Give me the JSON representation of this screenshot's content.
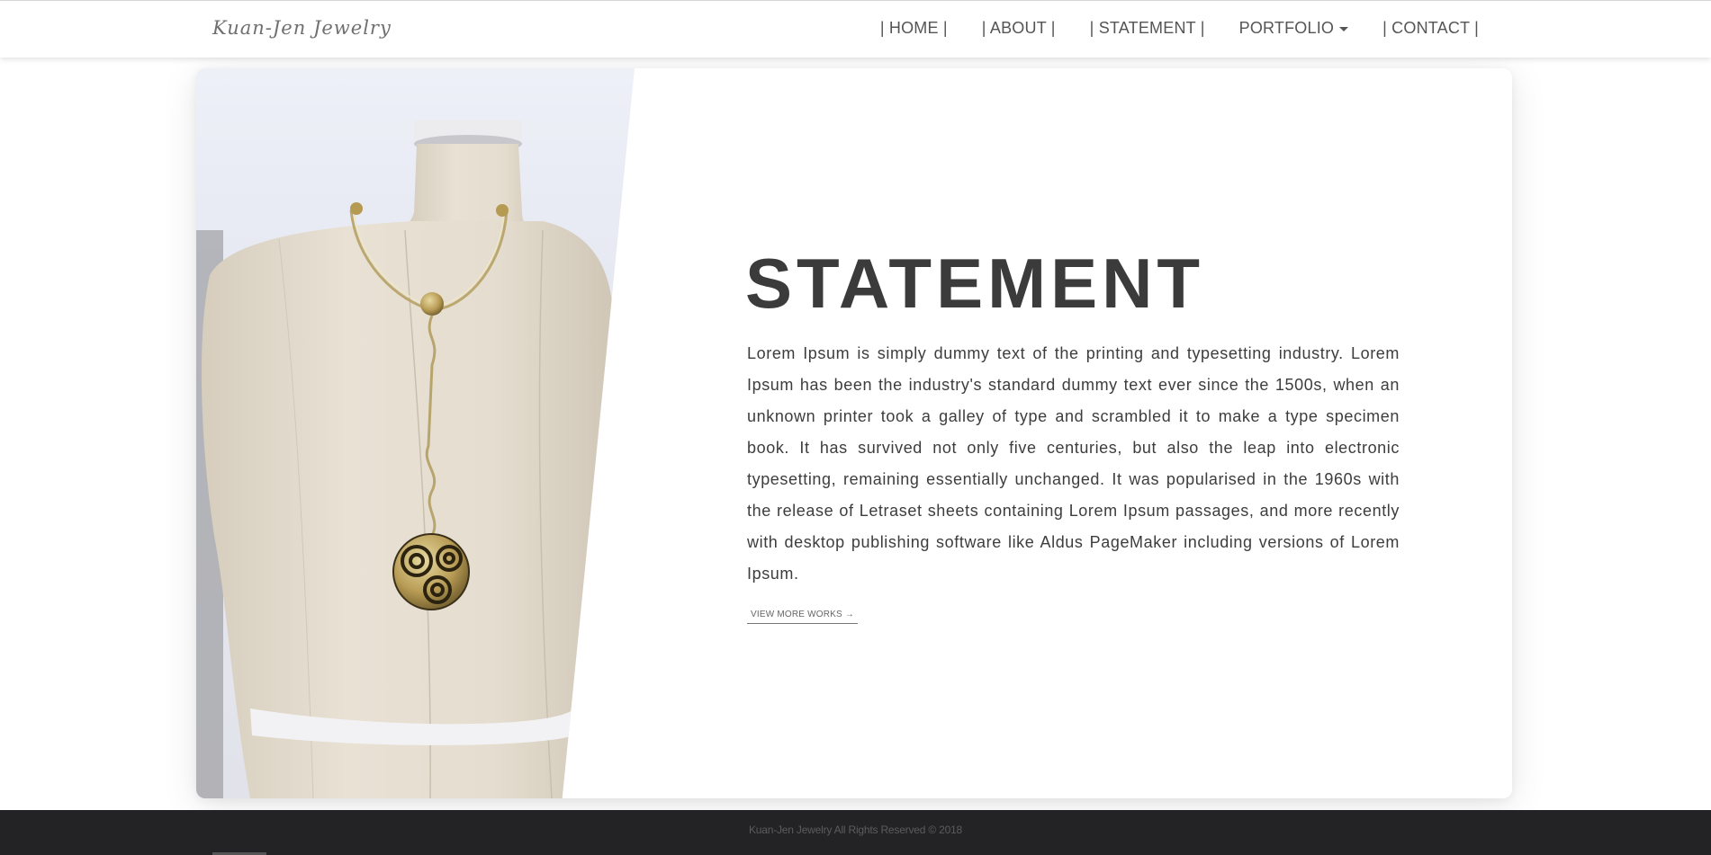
{
  "brand": {
    "name": "Kuan-Jen Jewelry"
  },
  "nav": {
    "items": [
      {
        "label": "| HOME |"
      },
      {
        "label": "| ABOUT |"
      },
      {
        "label": "| STATEMENT |"
      },
      {
        "label": "PORTFOLIO",
        "has_dropdown": true
      },
      {
        "label": "| CONTACT |"
      }
    ]
  },
  "hero": {
    "image": "necklace-on-mannequin",
    "title": "STATEMENT",
    "body": "Lorem Ipsum is simply dummy text of the printing and typesetting industry. Lorem Ipsum has been the industry's standard dummy text ever since the 1500s, when an unknown printer took a galley of type and scrambled it to make a type specimen book. It has survived not only five centuries, but also the leap into electronic typesetting, remaining essentially unchanged. It was popularised in the 1960s with the release of Letraset sheets containing Lorem Ipsum passages, and more recently with desktop publishing software like Aldus PageMaker including versions of Lorem Ipsum.",
    "link_label": "VIEW MORE WORKS →"
  },
  "footer": {
    "text": "Kuan-Jen Jewelry All Rights Reserved © 2018"
  },
  "colors": {
    "title": "#3b3b3b",
    "footer_bg": "#232325",
    "mannequin": "#e4ddd0"
  }
}
